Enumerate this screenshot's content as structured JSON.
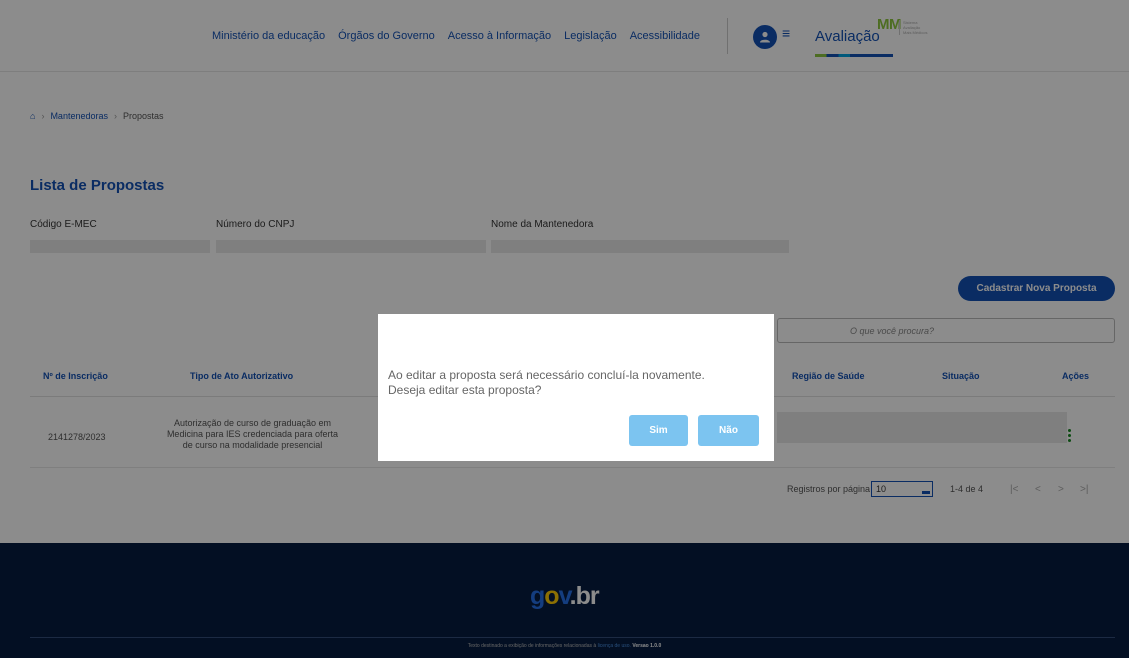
{
  "header": {
    "nav": [
      "Ministério da educação",
      "Órgãos do Governo",
      "Acesso à Informação",
      "Legislação",
      "Acessibilidade"
    ],
    "logo_mm": "MM",
    "logo_text": "Avaliação",
    "logo_small": [
      "Sistema",
      "Avaliação",
      "Mais Médicos"
    ]
  },
  "breadcrumb": {
    "link": "Mantenedoras",
    "current": "Propostas"
  },
  "page_title": "Lista de Propostas",
  "filters": {
    "codigo": "Código E-MEC",
    "cnpj": "Número do CNPJ",
    "nome": "Nome da Mantenedora"
  },
  "actions": {
    "new_button": "Cadastrar Nova Proposta",
    "search_placeholder": "O que você procura?"
  },
  "table": {
    "headers": {
      "inscricao": "Nº de Inscrição",
      "tipo": "Tipo de Ato Autorizativo",
      "regiao": "Região de Saúde",
      "situacao": "Situação",
      "acoes": "Ações"
    },
    "row": {
      "inscricao": "2141278/2023",
      "tipo": [
        "Autorização de curso de graduação em",
        "Medicina para IES credenciada para oferta",
        "de curso na modalidade presencial"
      ]
    }
  },
  "pagination": {
    "label": "Registros por página",
    "per_page": "10",
    "range": "1-4 de 4",
    "buttons": [
      "|<",
      "<",
      ">",
      ">|"
    ]
  },
  "footer": {
    "logo": {
      "g": "g",
      "o": "o",
      "v": "v",
      "dot": ".",
      "br": "br"
    },
    "text_prefix": "Texto destinado a exibição de informações relacionadas à",
    "text_link": "licença de uso.",
    "version": "Versao 1.0.0"
  },
  "modal": {
    "line1": "Ao editar a proposta será necessário concluí-la novamente.",
    "line2": "Deseja editar esta proposta?",
    "yes": "Sim",
    "no": "Não"
  }
}
